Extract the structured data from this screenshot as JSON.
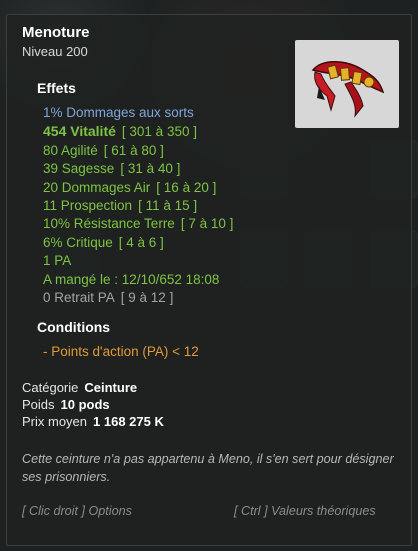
{
  "item": {
    "name": "Menoture",
    "level": "Niveau  200",
    "icon": "belt-item-icon"
  },
  "sections": {
    "effects": "Effets",
    "conditions": "Conditions"
  },
  "effects": [
    {
      "text": "1% Dommages aux sorts",
      "range": "",
      "color": "#7fa6d8"
    },
    {
      "text": "454 Vitalité",
      "range": "[ 301 à 350 ]",
      "color": "#7ec443"
    },
    {
      "text": "80 Agilité",
      "range": "[ 61 à 80 ]",
      "color": "#7ec443"
    },
    {
      "text": "39 Sagesse",
      "range": "[ 31 à 40 ]",
      "color": "#7ec443"
    },
    {
      "text": "20 Dommages Air",
      "range": "[ 16 à 20 ]",
      "color": "#7ec443"
    },
    {
      "text": "11 Prospection",
      "range": "[ 11 à 15 ]",
      "color": "#7ec443"
    },
    {
      "text": "10% Résistance Terre",
      "range": "[ 7 à 10 ]",
      "color": "#7ec443"
    },
    {
      "text": "6% Critique",
      "range": "[ 4 à 6 ]",
      "color": "#7ec443"
    },
    {
      "text": "1 PA",
      "range": "",
      "color": "#7ec443"
    },
    {
      "text": "A mangé le : 12/10/652 18:08",
      "range": "",
      "color": "#7ec443"
    },
    {
      "text": "0 Retrait PA",
      "range": "[ 9 à 12 ]",
      "color": "#a3a3a3"
    }
  ],
  "condition": "- Points d'action (PA) < 12",
  "info": {
    "category_label": "Catégorie",
    "category_value": "Ceinture",
    "weight_label": "Poids",
    "weight_value": "10 pods",
    "price_label": "Prix moyen",
    "price_value": "1 168 275 K"
  },
  "description": "Cette ceinture n'a pas appartenu à Meno, il s'en sert pour désigner ses prisonniers.",
  "hints": {
    "right_click": "[ Clic droit ] Options",
    "ctrl": "[ Ctrl ] Valeurs théoriques"
  },
  "colors": {
    "accent_green": "#7ec443",
    "spell_blue": "#7fa6d8",
    "condition_orange": "#e29a36"
  }
}
